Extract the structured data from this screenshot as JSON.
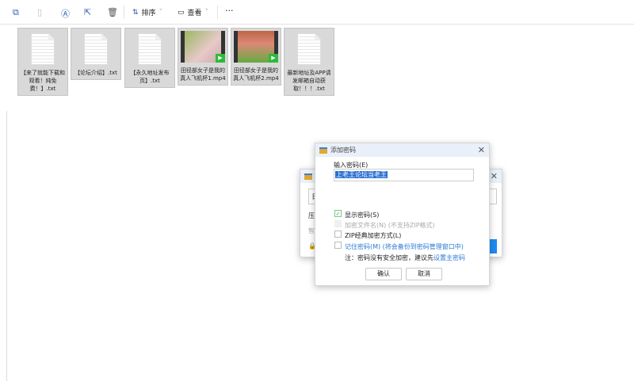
{
  "toolbar": {
    "sort_label": "排序",
    "view_label": "查看",
    "more_label": "···"
  },
  "files": [
    {
      "name": "【来了就能下载和观看！纯免费！】.txt",
      "type": "txt"
    },
    {
      "name": "【论坛介绍】.txt",
      "type": "txt"
    },
    {
      "name": "【永久地址发布页】.txt",
      "type": "txt"
    },
    {
      "name": "田径部女子是我的真人飞机杯1.mp4",
      "type": "mp4"
    },
    {
      "name": "田径部女子是我的真人飞机杯2.mp4",
      "type": "mp4"
    },
    {
      "name": "最新地址及APP请发邮箱自动获取！！！.txt",
      "type": "txt"
    }
  ],
  "back_dialog": {
    "field_char": "田",
    "label1": "压",
    "label2": "智"
  },
  "dialog": {
    "title": "添加密码",
    "password_label": "输入密码(E)",
    "password_value": "上老王论坛当老王",
    "show_password": "显示密码(S)",
    "encrypt_names": "加密文件名(N) (不支持ZIP格式)",
    "zip_classic": "ZIP经典加密方式(L)",
    "remember": "记住密码(M) (将会备份到密码管理窗口中)",
    "note": "注：密码没有安全加密，建议先",
    "note_link": "设置主密码",
    "ok": "确认",
    "cancel": "取消"
  }
}
